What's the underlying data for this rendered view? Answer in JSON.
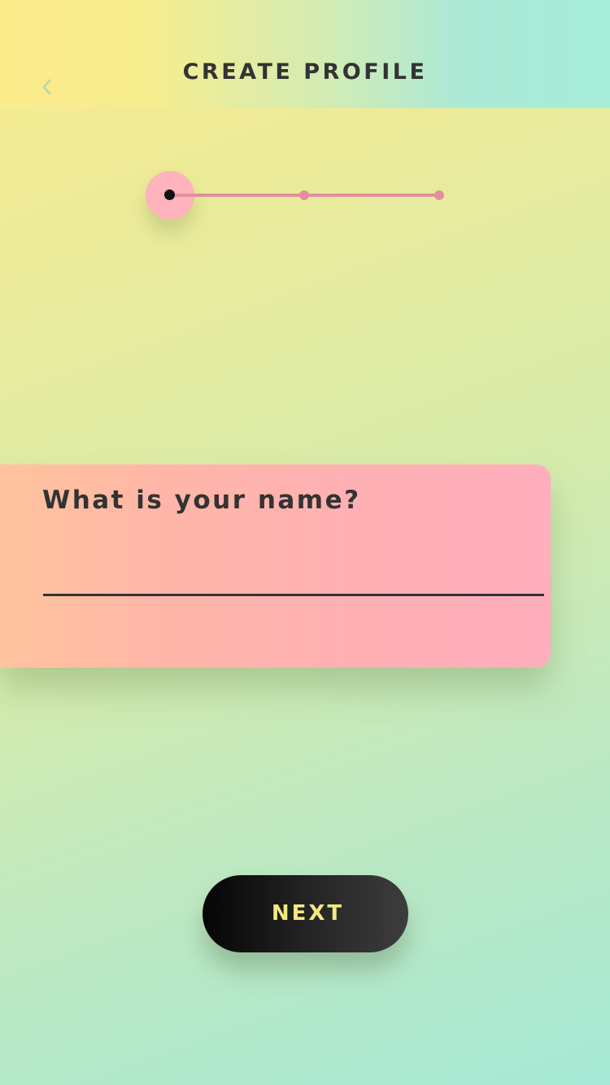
{
  "header": {
    "title": "CREATE PROFILE",
    "back_icon": "chevron-left-icon"
  },
  "stepper": {
    "total_steps": 3,
    "current_step": 1
  },
  "form": {
    "question": "What is your name?",
    "name_value": "",
    "name_placeholder": ""
  },
  "actions": {
    "next_label": "NEXT"
  },
  "colors": {
    "accent_pink": "#ffb3bb",
    "step_line": "#e38f9f",
    "text_dark": "#333333",
    "button_text": "#f3e87f",
    "gradient_yellow": "#f9ec8f",
    "gradient_mint": "#a6e9d6"
  }
}
